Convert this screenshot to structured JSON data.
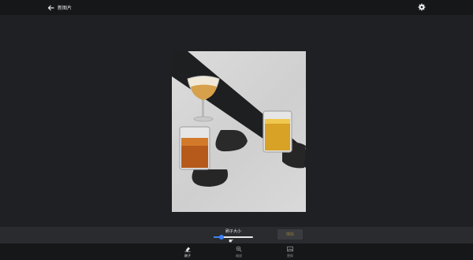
{
  "header": {
    "back_icon": "arrow-left-icon",
    "title": "新图片",
    "settings_icon": "gear-icon"
  },
  "canvas": {
    "image_alt": "cocktail glasses photo"
  },
  "panel": {
    "brush_label": "刷子大小",
    "brush_size": 0.2,
    "erase_label": "擦除",
    "cursor_icon": "hand-pointer-icon"
  },
  "nav": {
    "items": [
      {
        "label": "刷子",
        "icon": "eraser-icon",
        "active": true
      },
      {
        "label": "缩放",
        "icon": "zoom-icon",
        "active": false
      },
      {
        "label": "更换",
        "icon": "image-icon",
        "active": false
      }
    ]
  },
  "colors": {
    "background": "#1e1f22",
    "accent": "#3b82f6",
    "bar": "#161719",
    "panel": "#2a2b2f"
  }
}
